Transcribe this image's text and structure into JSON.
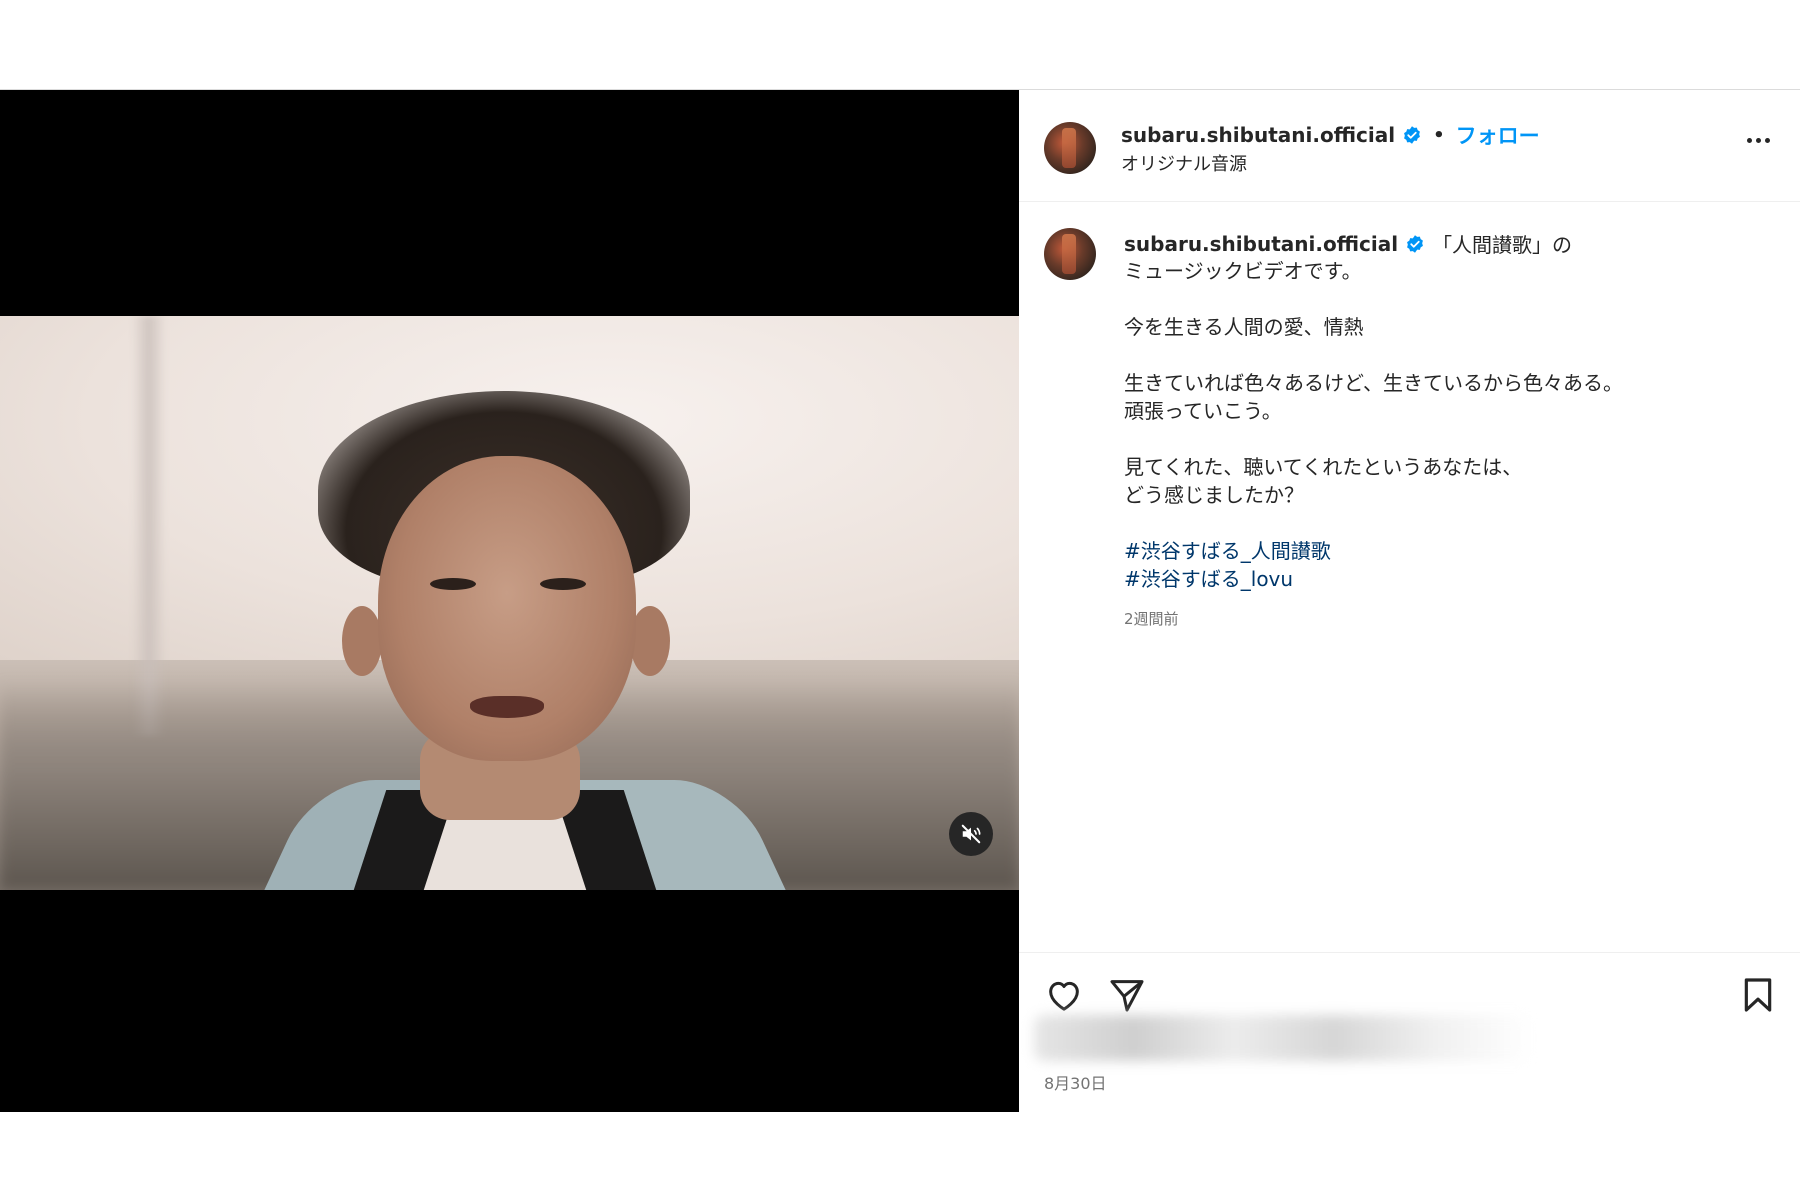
{
  "header": {
    "username": "subaru.shibutani.official",
    "separator": "•",
    "follow_label": "フォロー",
    "audio_label": "オリジナル音源"
  },
  "caption": {
    "username": "subaru.shibutani.official",
    "first_line": "「人間讃歌」の",
    "lines": [
      "ミュージックビデオです。",
      "",
      "今を生きる人間の愛、情熱",
      "",
      "生きていれば色々あるけど、生きているから色々ある。",
      "頑張っていこう。",
      "",
      "見てくれた、聴いてくれたというあなたは、",
      "どう感じましたか？",
      ""
    ],
    "hashtags": [
      "#渋谷すばる_人間讃歌",
      "#渋谷すばる_lovu"
    ],
    "time_ago": "2週間前"
  },
  "footer": {
    "date": "8月30日"
  },
  "icons": {
    "verified": "verified-badge-icon",
    "more": "more-options-icon",
    "like": "heart-icon",
    "share": "paper-plane-icon",
    "save": "bookmark-icon",
    "mute": "speaker-muted-icon"
  },
  "colors": {
    "follow": "#0095f6",
    "hashtag": "#00376b",
    "muted_text": "#737373",
    "verified": "#0095f6"
  }
}
